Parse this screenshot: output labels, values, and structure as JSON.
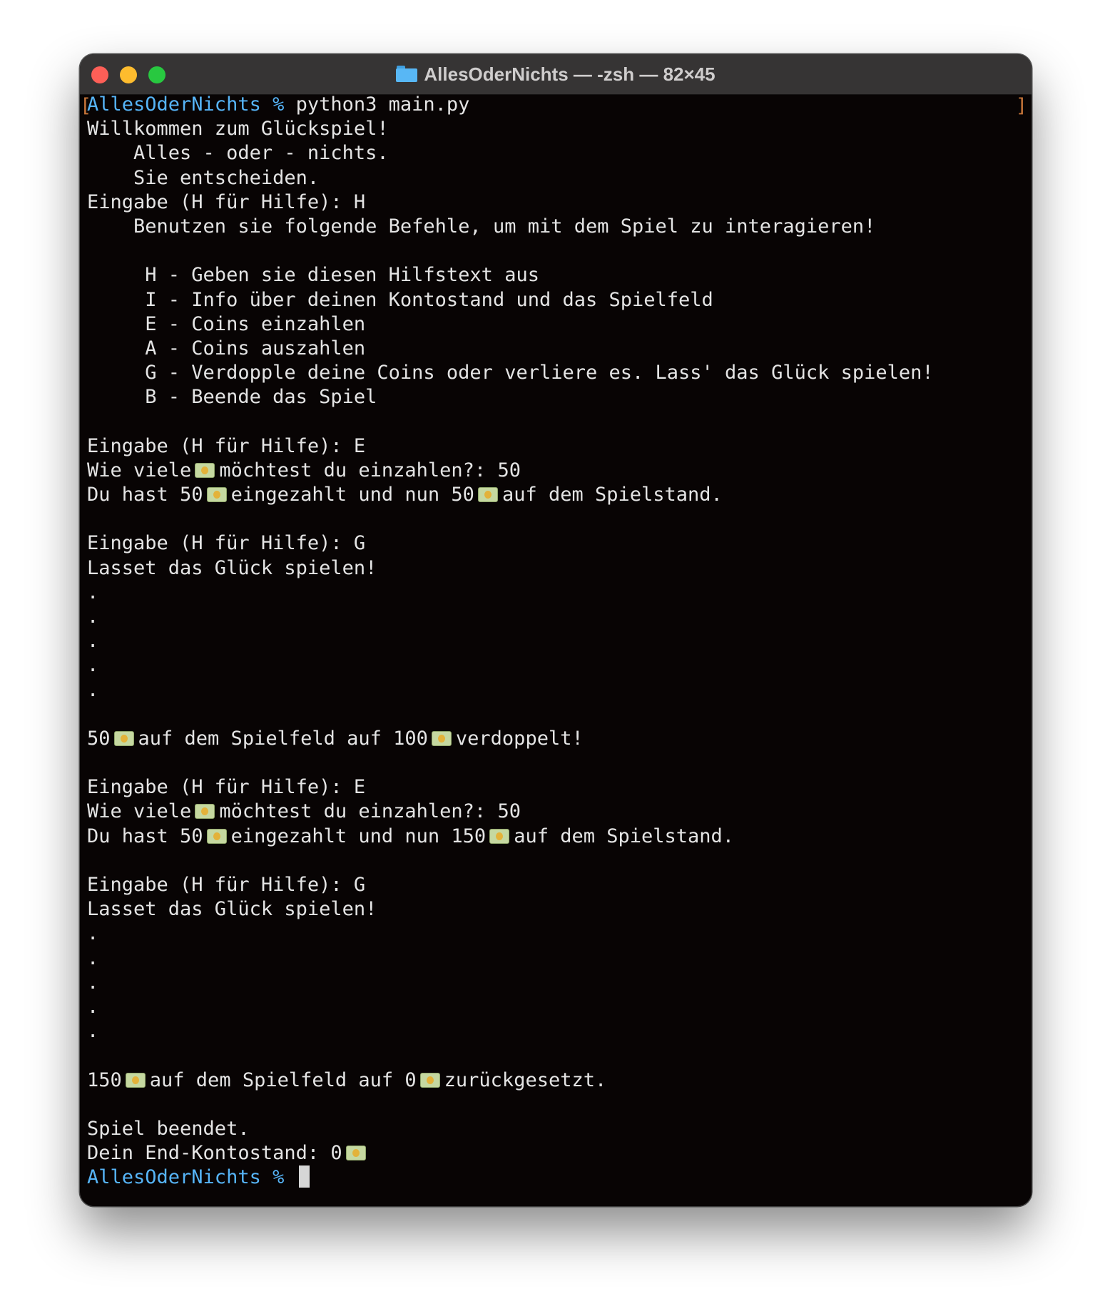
{
  "window": {
    "title": "AllesOderNichts — -zsh — 82×45"
  },
  "icons": {
    "emoji": "money-bill-emoji-icon",
    "folder": "folder-icon"
  },
  "colors": {
    "terminal_bg": "#080404",
    "prompt": "#56b4f7",
    "text": "#e4e4e4"
  },
  "terminal": {
    "prompt": "AllesOderNichts %",
    "lines": [
      {
        "segments": [
          {
            "t": "AllesOderNichts %",
            "prompt": true
          },
          {
            "t": " python3 main.py"
          }
        ]
      },
      {
        "segments": [
          {
            "t": "Willkommen zum Glückspiel!"
          }
        ]
      },
      {
        "segments": [
          {
            "t": "    Alles - oder - nichts."
          }
        ]
      },
      {
        "segments": [
          {
            "t": "    Sie entscheiden."
          }
        ]
      },
      {
        "segments": [
          {
            "t": "Eingabe (H für Hilfe): H"
          }
        ]
      },
      {
        "segments": [
          {
            "t": "    Benutzen sie folgende Befehle, um mit dem Spiel zu interagieren!"
          }
        ]
      },
      {
        "segments": []
      },
      {
        "segments": [
          {
            "t": "     H - Geben sie diesen Hilfstext aus"
          }
        ]
      },
      {
        "segments": [
          {
            "t": "     I - Info über deinen Kontostand und das Spielfeld"
          }
        ]
      },
      {
        "segments": [
          {
            "t": "     E - Coins einzahlen"
          }
        ]
      },
      {
        "segments": [
          {
            "t": "     A - Coins auszahlen"
          }
        ]
      },
      {
        "segments": [
          {
            "t": "     G - Verdopple deine Coins oder verliere es. Lass' das Glück spielen!"
          }
        ]
      },
      {
        "segments": [
          {
            "t": "     B - Beende das Spiel"
          }
        ]
      },
      {
        "segments": []
      },
      {
        "segments": [
          {
            "t": "Eingabe (H für Hilfe): E"
          }
        ]
      },
      {
        "segments": [
          {
            "t": "Wie viele"
          },
          {
            "emoji": true
          },
          {
            "t": "möchtest du einzahlen?: 50"
          }
        ]
      },
      {
        "segments": [
          {
            "t": "Du hast 50"
          },
          {
            "emoji": true
          },
          {
            "t": "eingezahlt und nun 50"
          },
          {
            "emoji": true
          },
          {
            "t": "auf dem Spielstand."
          }
        ]
      },
      {
        "segments": []
      },
      {
        "segments": [
          {
            "t": "Eingabe (H für Hilfe): G"
          }
        ]
      },
      {
        "segments": [
          {
            "t": "Lasset das Glück spielen!"
          }
        ]
      },
      {
        "segments": [
          {
            "t": "."
          }
        ]
      },
      {
        "segments": [
          {
            "t": "."
          }
        ]
      },
      {
        "segments": [
          {
            "t": "."
          }
        ]
      },
      {
        "segments": [
          {
            "t": "."
          }
        ]
      },
      {
        "segments": [
          {
            "t": "."
          }
        ]
      },
      {
        "segments": []
      },
      {
        "segments": [
          {
            "t": "50"
          },
          {
            "emoji": true
          },
          {
            "t": "auf dem Spielfeld auf 100"
          },
          {
            "emoji": true
          },
          {
            "t": "verdoppelt!"
          }
        ]
      },
      {
        "segments": []
      },
      {
        "segments": [
          {
            "t": "Eingabe (H für Hilfe): E"
          }
        ]
      },
      {
        "segments": [
          {
            "t": "Wie viele"
          },
          {
            "emoji": true
          },
          {
            "t": "möchtest du einzahlen?: 50"
          }
        ]
      },
      {
        "segments": [
          {
            "t": "Du hast 50"
          },
          {
            "emoji": true
          },
          {
            "t": "eingezahlt und nun 150"
          },
          {
            "emoji": true
          },
          {
            "t": "auf dem Spielstand."
          }
        ]
      },
      {
        "segments": []
      },
      {
        "segments": [
          {
            "t": "Eingabe (H für Hilfe): G"
          }
        ]
      },
      {
        "segments": [
          {
            "t": "Lasset das Glück spielen!"
          }
        ]
      },
      {
        "segments": [
          {
            "t": "."
          }
        ]
      },
      {
        "segments": [
          {
            "t": "."
          }
        ]
      },
      {
        "segments": [
          {
            "t": "."
          }
        ]
      },
      {
        "segments": [
          {
            "t": "."
          }
        ]
      },
      {
        "segments": [
          {
            "t": "."
          }
        ]
      },
      {
        "segments": []
      },
      {
        "segments": [
          {
            "t": "150"
          },
          {
            "emoji": true
          },
          {
            "t": "auf dem Spielfeld auf 0"
          },
          {
            "emoji": true
          },
          {
            "t": "zurückgesetzt."
          }
        ]
      },
      {
        "segments": []
      },
      {
        "segments": [
          {
            "t": "Spiel beendet."
          }
        ]
      },
      {
        "segments": [
          {
            "t": "Dein End-Kontostand: 0"
          },
          {
            "emoji": true
          }
        ]
      },
      {
        "segments": [
          {
            "t": "AllesOderNichts %",
            "prompt": true
          },
          {
            "t": " "
          },
          {
            "cursor": true
          }
        ]
      }
    ]
  }
}
